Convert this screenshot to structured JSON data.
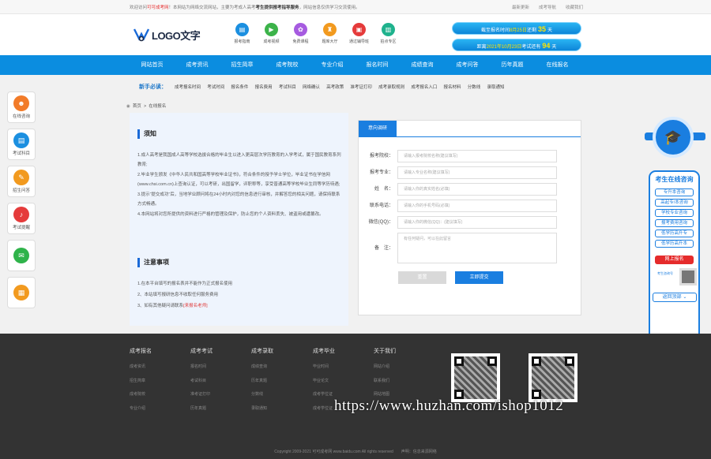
{
  "topbar": {
    "welcome_prefix": "欢迎访问",
    "brand": "可可成考网",
    "welcome_mid": "！本网站为网络交流网站，主要为考成人高考",
    "highlight": "考生提供报考指导服务",
    "welcome_suffix": "，网站信息仅供学习交流使用。",
    "links": [
      "最新更新",
      "成考导航",
      "收藏我们"
    ]
  },
  "header": {
    "logo_text": "LOGO文字",
    "quick_links": [
      {
        "label": "报考指南",
        "icon": "book-icon",
        "color": "#1b8fe0"
      },
      {
        "label": "成考视频",
        "icon": "video-icon",
        "color": "#3cb34a"
      },
      {
        "label": "免费课程",
        "icon": "gift-icon",
        "color": "#a65be0"
      },
      {
        "label": "题库大厅",
        "icon": "library-icon",
        "color": "#f29a1f"
      },
      {
        "label": "通过辅导班",
        "icon": "class-icon",
        "color": "#e53b3b"
      },
      {
        "label": "拍点专区",
        "icon": "zone-icon",
        "color": "#1fb28d"
      }
    ],
    "countdowns": [
      {
        "prefix": "截至报名时间",
        "date": "8月25日",
        "mid": "还剩",
        "days": "35",
        "suffix": "天"
      },
      {
        "prefix": "距离",
        "date": "2021年10月23日",
        "mid": "考试还有",
        "days": "94",
        "suffix": "天"
      }
    ]
  },
  "nav": [
    "网站首页",
    "成考资讯",
    "招生简章",
    "成考院校",
    "专业介绍",
    "报名时间",
    "成绩查询",
    "成考问答",
    "历年真题",
    "在线报名"
  ],
  "subnav": {
    "heading": "新手必读：",
    "items": [
      "成考报名时间",
      "考试时间",
      "报名条件",
      "报名费用",
      "考试科目",
      "网络确认",
      "高考政策",
      "准考证打印",
      "成考录取规则",
      "成考报名入口",
      "报名材料",
      "分数线",
      "录取通知"
    ]
  },
  "breadcrumb": {
    "items": [
      "首页",
      ">",
      "在线报名"
    ]
  },
  "notice": {
    "title": "须知",
    "paragraphs": [
      "1.成人高考是我国成人高等学校选拔合格的毕业生以进入更高层次学历教育的入学考试，属于国民教育系列教育;",
      "2.毕业学生颁发《中华人民共和国高等学校毕业证书》，符合条件的授予学士学位，毕业证书在学信网(www.chsi.com.cn)上查询认证，可以考研，出国留学，评职称等，享受普通高等学校毕业生同等学历待遇;",
      "3.提示“提交成功”后，当地学业顾问将在24小时内对您的信息进行审核，并解答您的相关问题，请保持联系方式畅通。",
      "4.本网站将对您所提供的资料进行严格的管理及保护，防止您的个人资料丢失、被盗用或遭篡改。"
    ],
    "attention_title": "注意事项",
    "attention": [
      "1.在本平台填写的报名表并不能作为正式报名使用",
      "2、本站填写报研信息不收取任何服务费用",
      "3、如有其他疑问请联系"
    ],
    "contact_link": "[来报名老师]"
  },
  "form": {
    "tab": "意向调研",
    "fields": [
      {
        "label": "报考院校：",
        "placeholder": "请输入报考院校名称(建议填写)"
      },
      {
        "label": "报考专业：",
        "placeholder": "请输入专业名称(建议填写)"
      },
      {
        "label": "姓　名：",
        "placeholder": "请输入你的真实姓名(必填)"
      },
      {
        "label": "联系电话：",
        "placeholder": "请输入你的手机号码(必填)"
      },
      {
        "label": "微信(QQ)：",
        "placeholder": "请输入你的微信(QQ)：(建议填写)"
      },
      {
        "label": "备　注：",
        "placeholder": "有任何疑问，可以在此留言"
      }
    ],
    "reset": "重置",
    "submit": "立即提交"
  },
  "side_left": [
    {
      "label": "在线咨询",
      "icon": "chat-icon",
      "color": "#f27b28"
    },
    {
      "label": "考试科目",
      "icon": "subject-icon",
      "color": "#1b8fe0"
    },
    {
      "label": "招生问答",
      "icon": "qa-icon",
      "color": "#f29a1f"
    },
    {
      "label": "考试提醒",
      "icon": "bell-icon",
      "color": "#e53b3b"
    },
    {
      "label": "",
      "icon": "wechat-icon",
      "color": "#2fb34a"
    },
    {
      "label": "",
      "icon": "calendar-icon",
      "color": "#f29a1f"
    }
  ],
  "side_right": {
    "title": "考生在线咨询",
    "links": [
      "专升本咨询",
      "高起专/本咨询",
      "学校专业咨询",
      "报考费用咨询",
      "低学历高升专",
      "低学历高升本"
    ],
    "apply": "网上报名",
    "qr_label": "考生咨询号",
    "back_top": "返回顶部"
  },
  "footer": {
    "columns": [
      {
        "heading": "成考报名",
        "items": [
          "成考资讯",
          "招生简章",
          "成考院校",
          "专业介绍"
        ]
      },
      {
        "heading": "成考考试",
        "items": [
          "报名时间",
          "考试科目",
          "准考证打印",
          "历年真题"
        ]
      },
      {
        "heading": "成考录取",
        "items": [
          "成绩查询",
          "历年真题",
          "分数线",
          "录取通知"
        ]
      },
      {
        "heading": "成考毕业",
        "items": [
          "毕业时间",
          "毕业论文",
          "成考学位证",
          "成考学位证"
        ]
      },
      {
        "heading": "关于我们",
        "items": [
          "网站介绍",
          "联系我们",
          "网站地图"
        ]
      }
    ],
    "copyright": "Copyright 2009-2021 可可成考网 www.baidu.com All rights reserved　　声明：信息来源网络"
  },
  "watermark": "https://www.huzhan.com/ishop1012"
}
